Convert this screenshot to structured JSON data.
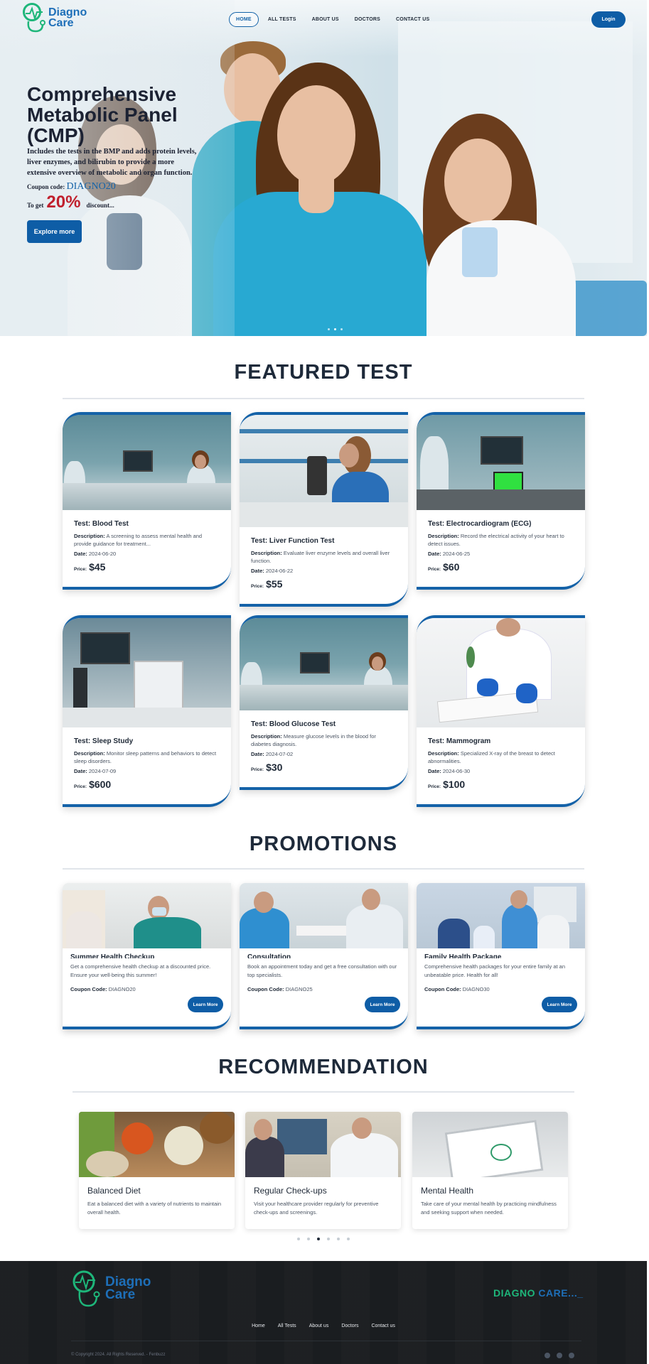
{
  "brand": {
    "line1": "Diagno",
    "line2": "Care"
  },
  "nav": {
    "items": [
      "HOME",
      "ALL TESTS",
      "ABOUT US",
      "DOCTORS",
      "CONTACT US"
    ],
    "active": "HOME",
    "login_label": "Login"
  },
  "hero": {
    "title": "Comprehensive Metabolic Panel (CMP)",
    "description": "Includes the tests in the BMP and adds protein levels, liver enzymes, and bilirubin to provide a more extensive overview of metabolic and organ function.",
    "coupon_prefix": "Coupon code:",
    "coupon_code": "DIAGNO20",
    "discount_prefix": "To get",
    "discount_value": "20%",
    "discount_suffix": "discount...",
    "cta_label": "Explore more"
  },
  "featured": {
    "title": "FEATURED TEST",
    "labels": {
      "description": "Description:",
      "date": "Date:",
      "price": "Price:"
    },
    "tests": [
      {
        "name": "Test: Blood Test",
        "description": "A screening to assess mental health and provide guidance for treatment...",
        "date": "2024-06-20",
        "price": "$45"
      },
      {
        "name": "Test: Liver Function Test",
        "description": "Evaluate liver enzyme levels and overall liver function.",
        "date": "2024-06-22",
        "price": "$55"
      },
      {
        "name": "Test: Electrocardiogram (ECG)",
        "description": "Record the electrical activity of your heart to detect issues.",
        "date": "2024-06-25",
        "price": "$60"
      },
      {
        "name": "Test: Sleep Study",
        "description": "Monitor sleep patterns and behaviors to detect sleep disorders.",
        "date": "2024-07-09",
        "price": "$600"
      },
      {
        "name": "Test: Blood Glucose Test",
        "description": "Measure glucose levels in the blood for diabetes diagnosis.",
        "date": "2024-07-02",
        "price": "$30"
      },
      {
        "name": "Test: Mammogram",
        "description": "Specialized X-ray of the breast to detect abnormalities.",
        "date": "2024-06-30",
        "price": "$100"
      }
    ]
  },
  "promotions": {
    "title": "PROMOTIONS",
    "code_label": "Coupon Code:",
    "button_label": "Learn More",
    "items": [
      {
        "name": "Summer Health Checkup",
        "description": "Get a comprehensive health checkup at a discounted price. Ensure your well-being this summer!",
        "code": "DIAGNO20"
      },
      {
        "name": "Consultation",
        "description": "Book an appointment today and get a free consultation with our top specialists.",
        "code": "DIAGNO25"
      },
      {
        "name": "Family Health Package",
        "description": "Comprehensive health packages for your entire family at an unbeatable price. Health for all!",
        "code": "DIAGNO30"
      }
    ]
  },
  "recommendation": {
    "title": "RECOMMENDATION",
    "items": [
      {
        "name": "Balanced Diet",
        "description": "Eat a balanced diet with a variety of nutrients to maintain overall health."
      },
      {
        "name": "Regular Check-ups",
        "description": "Visit your healthcare provider regularly for preventive check-ups and screenings."
      },
      {
        "name": "Mental Health",
        "description": "Take care of your mental health by practicing mindfulness and seeking support when needed."
      }
    ],
    "carousel_dots": 6,
    "active_dot": 3
  },
  "footer": {
    "brand_a": "DIAGNO",
    "brand_b": "CARE..._",
    "links": [
      "Home",
      "All Tests",
      "About us",
      "Doctors",
      "Contact us"
    ],
    "copyright": "© Copyright 2024. All Rights Reserved. - Fenbuzz"
  },
  "colors": {
    "primary": "#0e5da6",
    "accent_green": "#1eb67a",
    "discount_red": "#c0202d",
    "footer_bg": "#1a1d20"
  }
}
